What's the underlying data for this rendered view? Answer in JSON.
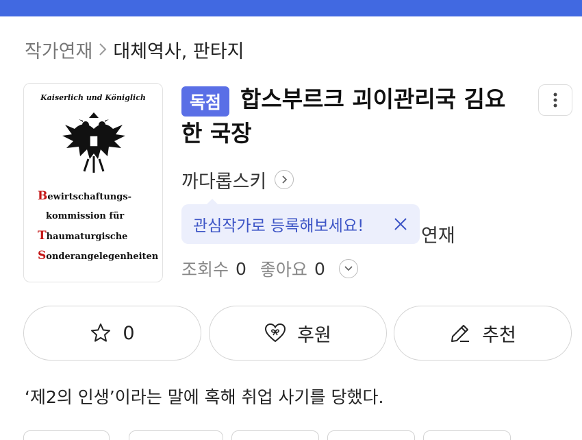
{
  "colors": {
    "top_bar": "#4169e1",
    "badge": "#5a6fe6",
    "tooltip_bg": "#eceffc",
    "tooltip_text": "#3d55c6"
  },
  "breadcrumb": {
    "category": "작가연재",
    "separator_icon": "chevron-right-icon",
    "subcategory": "대체역사, 판타지"
  },
  "cover": {
    "heading": "Kaiserlich und Königlich",
    "emblem_icon": "double-headed-eagle-icon",
    "lines": [
      {
        "cap": "B",
        "rest": "ewirtschaftungs-"
      },
      {
        "cap": "",
        "rest": "kommission für"
      },
      {
        "cap": "T",
        "rest": "haumaturgische"
      },
      {
        "cap": "S",
        "rest": "onderangelegenheiten"
      }
    ]
  },
  "novel": {
    "badge": "독점",
    "title": "합스부르크 괴이관리국 김요한 국장",
    "more_icon": "more-vertical-icon",
    "author": "까다롭스키",
    "author_icon": "chevron-right-icon",
    "status": "연재"
  },
  "tooltip": {
    "text": "관심작가로 등록해보세요!",
    "close_icon": "close-icon"
  },
  "stats": {
    "views_label": "조회수",
    "views": "0",
    "likes_label": "좋아요",
    "likes": "0",
    "expand_icon": "chevron-down-icon"
  },
  "actions": {
    "favorite": {
      "icon": "star-icon",
      "label": "0"
    },
    "support": {
      "icon": "heart-icon",
      "label": "후원"
    },
    "recommend": {
      "icon": "pencil-icon",
      "label": "추천"
    }
  },
  "description": "‘제2의 인생’이라는 말에 혹해 취업 사기를 당했다."
}
